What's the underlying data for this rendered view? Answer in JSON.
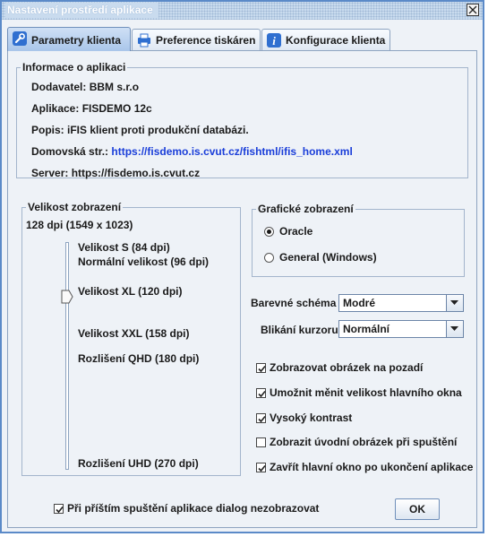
{
  "window": {
    "title": "Nastavení prostředí aplikace"
  },
  "tabs": [
    {
      "label": "Parametry klienta",
      "active": true
    },
    {
      "label": "Preference tiskáren",
      "active": false
    },
    {
      "label": "Konfigurace klienta",
      "active": false
    }
  ],
  "info": {
    "legend": "Informace o aplikaci",
    "rows": [
      {
        "label": "Dodavatel:",
        "value": "BBM s.r.o"
      },
      {
        "label": "Aplikace:",
        "value": "FISDEMO 12c"
      },
      {
        "label": "Popis:",
        "value": "iFIS klient proti produkční databázi."
      },
      {
        "label": "Domovská str.:",
        "value": "https://fisdemo.is.cvut.cz/fishtml/ifis_home.xml"
      },
      {
        "label": "Server:",
        "value": "https://fisdemo.is.cvut.cz"
      }
    ]
  },
  "size": {
    "legend": "Velikost zobrazení",
    "current": "128 dpi (1549 x 1023)",
    "ticks": [
      "Velikost S (84 dpi)",
      "Normální velikost (96 dpi)",
      "Velikost XL (120 dpi)",
      "Velikost XXL (158 dpi)",
      "Rozlišení QHD (180 dpi)",
      "Rozlišení UHD (270 dpi)"
    ],
    "slider_value_dpi": 128
  },
  "graphics": {
    "legend": "Grafické zobrazení",
    "options": [
      {
        "label": "Oracle",
        "selected": true
      },
      {
        "label": "General (Windows)",
        "selected": false
      }
    ]
  },
  "color_scheme": {
    "label": "Barevné schéma",
    "value": "Modré"
  },
  "cursor_blink": {
    "label": "Blikání kurzoru",
    "value": "Normální"
  },
  "checkboxes": [
    {
      "label": "Zobrazovat obrázek na pozadí",
      "checked": true
    },
    {
      "label": "Umožnit měnit velikost hlavního okna",
      "checked": true
    },
    {
      "label": "Vysoký kontrast",
      "checked": true
    },
    {
      "label": "Zobrazit úvodní obrázek při spuštění",
      "checked": false
    },
    {
      "label": "Zavřít hlavní okno po ukončení aplikace",
      "checked": true
    }
  ],
  "footer": {
    "dont_show": {
      "label": "Při příštím spuštění aplikace dialog nezobrazovat",
      "checked": true
    },
    "ok_label": "OK"
  },
  "colors": {
    "accent": "#5b8ac8",
    "link": "#1a3ed9",
    "panel": "#eef2f7"
  }
}
